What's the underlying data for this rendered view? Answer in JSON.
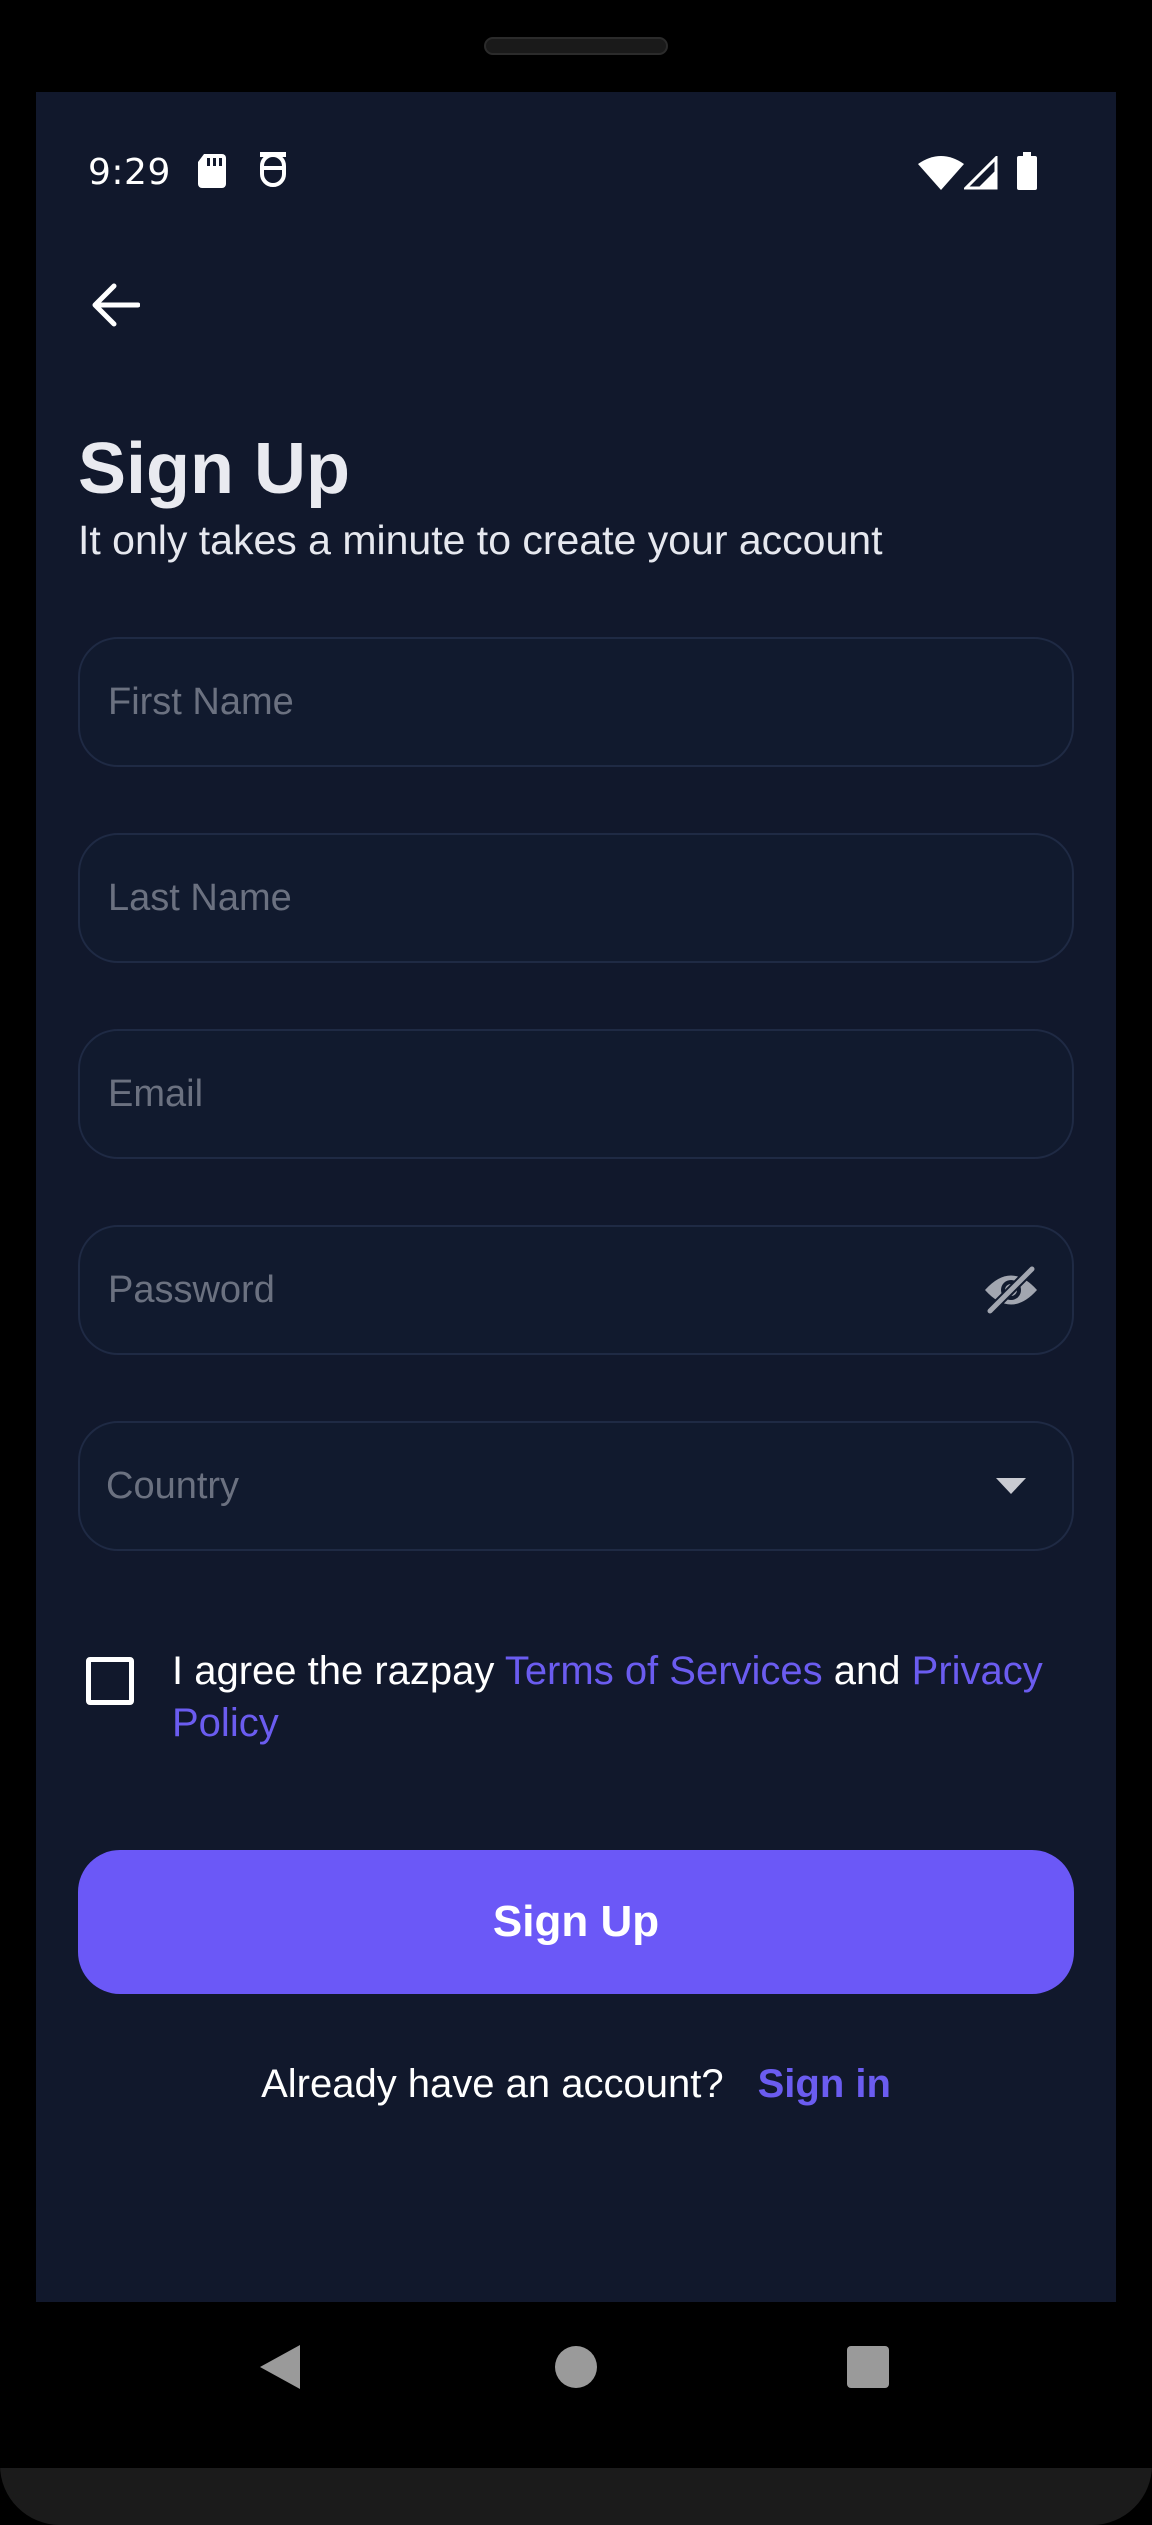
{
  "status_bar": {
    "time": "9:29",
    "left_icons": [
      "sd-card-icon",
      "notification-icon"
    ],
    "right_icons": [
      "wifi-icon",
      "cellular-signal-icon",
      "battery-icon"
    ]
  },
  "header": {
    "back_icon": "arrow-left-icon",
    "title": "Sign Up",
    "subtitle": "It only takes a minute to create your account"
  },
  "form": {
    "first_name": {
      "placeholder": "First Name",
      "value": ""
    },
    "last_name": {
      "placeholder": "Last Name",
      "value": ""
    },
    "email": {
      "placeholder": "Email",
      "value": ""
    },
    "password": {
      "placeholder": "Password",
      "value": "",
      "toggle_icon": "eye-off-icon"
    },
    "country": {
      "placeholder": "Country",
      "dropdown_icon": "caret-down-icon"
    }
  },
  "agreement": {
    "checked": false,
    "prefix": "I agree the razpay ",
    "terms_link": "Terms of Services",
    "conjunction": " and ",
    "privacy_link": "Privacy Policy"
  },
  "submit": {
    "label": "Sign Up"
  },
  "footer": {
    "prompt": "Already have an account?",
    "link": "Sign in"
  },
  "nav_bar": {
    "back": "nav-back-icon",
    "home": "nav-home-icon",
    "recents": "nav-recents-icon"
  },
  "colors": {
    "background": "#11182c",
    "accent": "#6b58f7",
    "link": "#6b5cf0",
    "placeholder": "#6b7180",
    "field_border": "#1f2a44"
  }
}
